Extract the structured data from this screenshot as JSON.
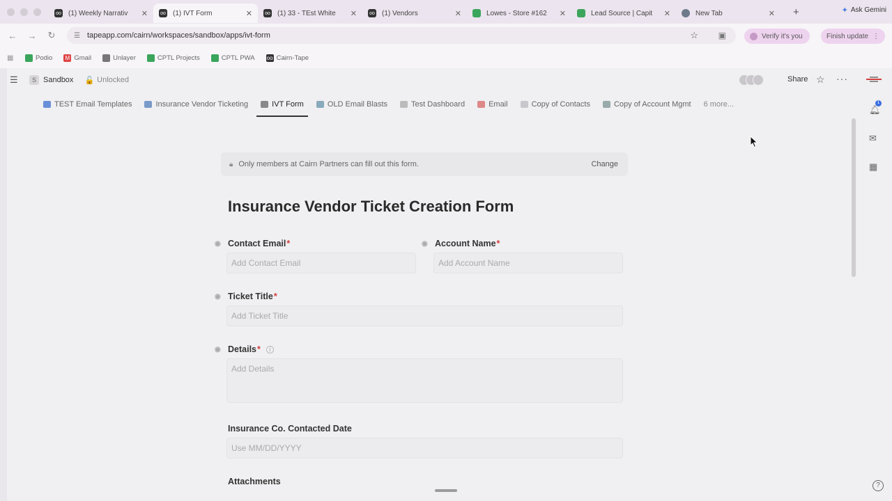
{
  "browser": {
    "tabs": [
      {
        "title": "(1) Weekly Narrativ",
        "icon": "tape-icon"
      },
      {
        "title": "(1) IVT Form",
        "icon": "tape-icon",
        "active": true
      },
      {
        "title": "(1) 33 - TEst White",
        "icon": "tape-icon"
      },
      {
        "title": "(1) Vendors",
        "icon": "tape-icon"
      },
      {
        "title": "Lowes - Store #162",
        "icon": "sheets-icon"
      },
      {
        "title": "Lead Source | Capit",
        "icon": "sheets-icon"
      },
      {
        "title": "New Tab",
        "icon": "chrome-icon"
      }
    ],
    "ask_gemini": "Ask Gemini",
    "url": "tapeapp.com/cairn/workspaces/sandbox/apps/ivt-form",
    "verify_label": "Verify it's you",
    "finish_update_label": "Finish update",
    "bookmarks": [
      "Podio",
      "Gmail",
      "Unlayer",
      "CPTL Projects",
      "CPTL PWA",
      "Cairn-Tape"
    ]
  },
  "app": {
    "workspace_initial": "S",
    "workspace_name": "Sandbox",
    "lock_state": "Unlocked",
    "share_label": "Share",
    "notification_count": "1",
    "tabs": [
      {
        "label": "TEST Email Templates"
      },
      {
        "label": "Insurance Vendor Ticketing"
      },
      {
        "label": "IVT Form",
        "active": true
      },
      {
        "label": "OLD Email Blasts"
      },
      {
        "label": "Test Dashboard"
      },
      {
        "label": "Email"
      },
      {
        "label": "Copy of Contacts"
      },
      {
        "label": "Copy of Account Mgmt"
      }
    ],
    "more_tabs": "6 more..."
  },
  "form": {
    "notice": "Only members at Cairn Partners can fill out this form.",
    "change_label": "Change",
    "title": "Insurance Vendor Ticket Creation Form",
    "fields": {
      "contact_email": {
        "label": "Contact Email",
        "placeholder": "Add Contact Email",
        "required": "*"
      },
      "account_name": {
        "label": "Account Name",
        "placeholder": "Add Account Name",
        "required": "*"
      },
      "ticket_title": {
        "label": "Ticket Title",
        "placeholder": "Add Ticket Title",
        "required": "*"
      },
      "details": {
        "label": "Details",
        "placeholder": "Add Details",
        "required": "*"
      },
      "contacted_date": {
        "label": "Insurance Co. Contacted Date",
        "placeholder": "Use MM/DD/YYYY"
      },
      "attachments": {
        "label": "Attachments"
      }
    }
  },
  "colors": {
    "accent": "#3a6ee0",
    "required": "#d04040"
  }
}
